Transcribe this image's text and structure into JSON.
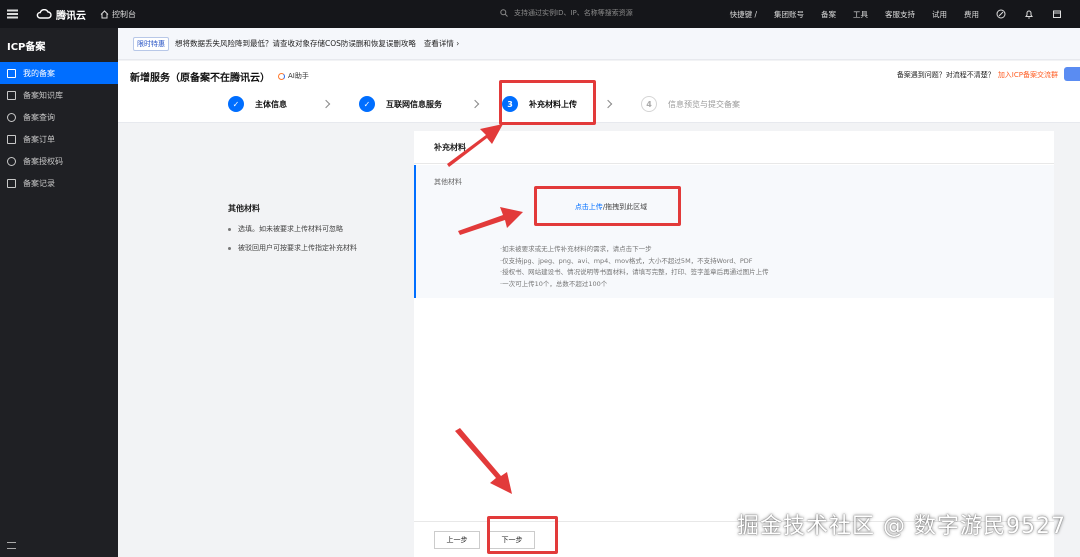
{
  "topbar": {
    "logo_text": "腾讯云",
    "console_label": "控制台",
    "search_placeholder": "支持通过实例ID、IP、名称等搜索资源",
    "shortcut_label": "快捷键 /",
    "links": [
      "集团账号",
      "备案",
      "工具",
      "客服支持",
      "试用",
      "费用"
    ]
  },
  "sidebar": {
    "title": "ICP备案",
    "items": [
      {
        "label": "我的备案",
        "icon": "doc-icon",
        "active": true
      },
      {
        "label": "备案知识库",
        "icon": "book-icon",
        "active": false
      },
      {
        "label": "备案查询",
        "icon": "search-icon",
        "active": false
      },
      {
        "label": "备案订单",
        "icon": "order-icon",
        "active": false
      },
      {
        "label": "备案授权码",
        "icon": "info-icon",
        "active": false
      },
      {
        "label": "备案记录",
        "icon": "record-icon",
        "active": false
      }
    ]
  },
  "notice": {
    "tag": "限时特惠",
    "text": "想将数据丢失风险降到最低？请查收对象存储COS防误删和恢复误删攻略",
    "link": "查看详情 ›"
  },
  "header": {
    "title": "新增服务（原备案不在腾讯云）",
    "ai_helper": "AI助手",
    "help_text": "备案遇到问题？对流程不清楚？",
    "help_link": "加入ICP备案交流群"
  },
  "steps": [
    {
      "number": "✓",
      "label": "主体信息",
      "state": "done"
    },
    {
      "number": "✓",
      "label": "互联网信息服务",
      "state": "done"
    },
    {
      "number": "3",
      "label": "补充材料上传",
      "state": "current"
    },
    {
      "number": "4",
      "label": "信息预览与提交备案",
      "state": "todo"
    }
  ],
  "left_tip": {
    "title": "其他材料",
    "items": [
      "选填。如未被要求上传材料可忽略",
      "被驳回用户可按要求上传指定补充材料"
    ]
  },
  "panel": {
    "title": "补充材料",
    "material_label": "其他材料",
    "upload_link": "点击上传",
    "upload_rest": "/拖拽到此区域",
    "notes": [
      "·如未被要求或无上传补充材料的需求，请点击下一步",
      "·仅支持jpg、jpeg、png、avi、mp4、mov格式，大小不超过5M，不支持Word、PDF",
      "·授权书、网站建设书、情况说明等书面材料，请填写完整，打印、签字盖章后再通过图片上传",
      "·一次可上传10个，总数不超过100个"
    ]
  },
  "footer": {
    "prev_label": "上一步",
    "next_label": "下一步"
  },
  "watermark": "掘金技术社区 @ 数字游民9527",
  "colors": {
    "accent": "#006eff",
    "annotation": "#e23a3a",
    "topbar": "#15161a",
    "sidebar": "#1f2024"
  }
}
